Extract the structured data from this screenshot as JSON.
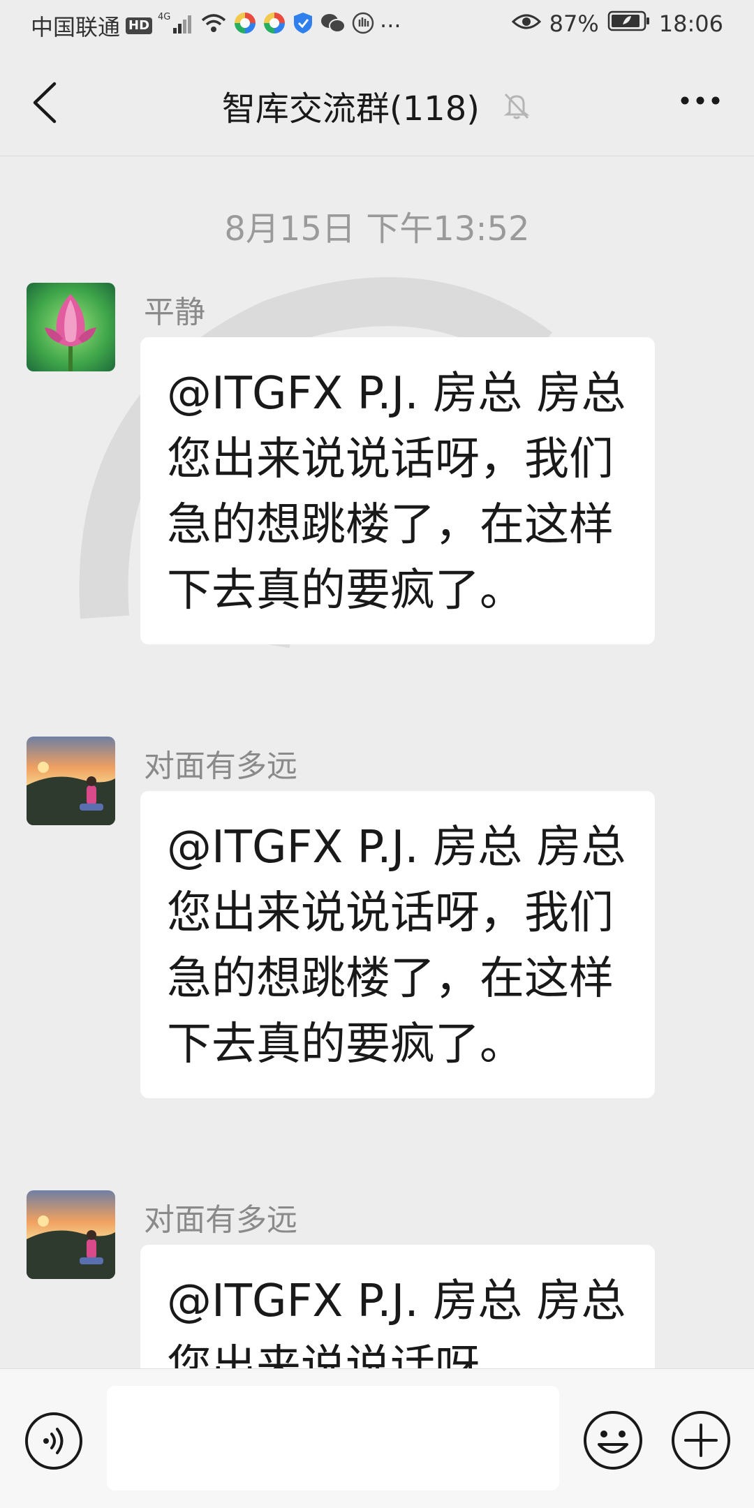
{
  "status_bar": {
    "carrier": "中国联通",
    "hd_badge": "HD",
    "network": "4G",
    "battery_percent": "87%",
    "time": "18:06"
  },
  "nav": {
    "title": "智库交流群(118)",
    "back_icon": "chevron-left-icon",
    "mute_icon": "bell-off-icon",
    "more_icon": "more-dots-icon"
  },
  "chat": {
    "timestamp": "8月15日 下午13:52",
    "messages": [
      {
        "sender": "平静",
        "avatar": "lotus-avatar",
        "text": "@ITGFX P.J. 房总  房总您出来说说话呀，我们急的想跳楼了，在这样下去真的要疯了。"
      },
      {
        "sender": "对面有多远",
        "avatar": "sunset-avatar",
        "text": "@ITGFX P.J. 房总  房总您出来说说话呀，我们急的想跳楼了，在这样下去真的要疯了。"
      },
      {
        "sender": "对面有多远",
        "avatar": "sunset-avatar",
        "text": "@ITGFX P.J. 房总  房总您出来说说话呀，"
      }
    ]
  },
  "input_bar": {
    "voice_icon": "voice-icon",
    "input_value": "",
    "emoji_icon": "emoji-icon",
    "plus_icon": "plus-icon"
  },
  "colors": {
    "background": "#ededed",
    "bubble": "#ffffff",
    "timestamp": "#9a9a9a",
    "sender": "#8a8a8a"
  }
}
